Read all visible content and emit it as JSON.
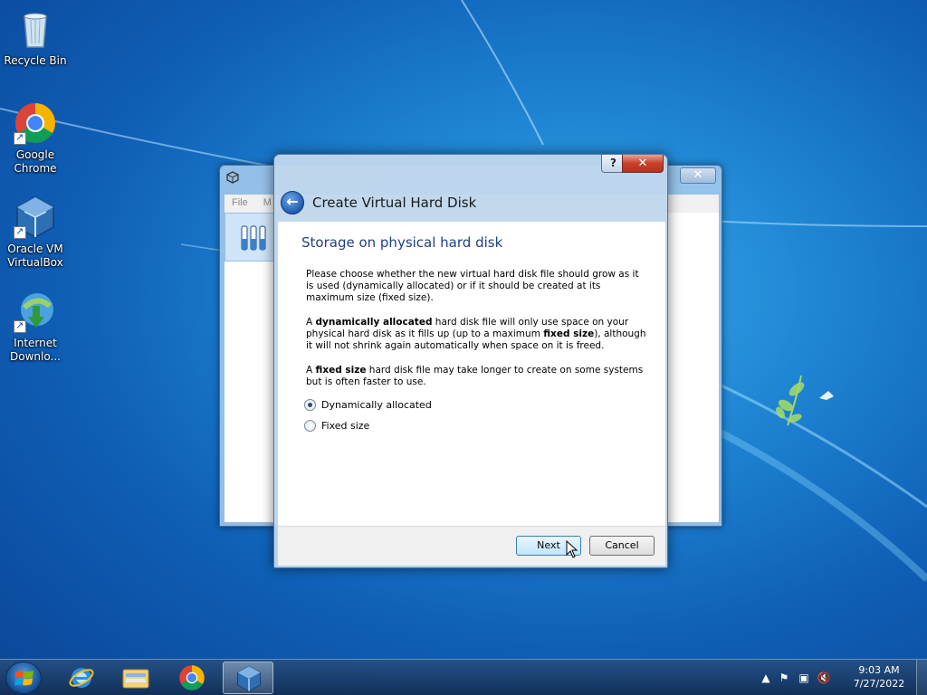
{
  "desktop": {
    "icons": [
      {
        "label": "Recycle Bin",
        "icon": "recycle-bin-icon"
      },
      {
        "label": "Google Chrome",
        "icon": "chrome-icon"
      },
      {
        "label": "Oracle VM VirtualBox",
        "icon": "virtualbox-icon"
      },
      {
        "label": "Internet Downlo...",
        "icon": "idm-icon"
      }
    ]
  },
  "background_window": {
    "menu_file": "File",
    "menu_m": "M"
  },
  "dialog": {
    "title": "Create Virtual Hard Disk",
    "help_label": "?",
    "close_label": "✕",
    "heading": "Storage on physical hard disk",
    "para1": "Please choose whether the new virtual hard disk file should grow as it is used (dynamically allocated) or if it should be created at its maximum size (fixed size).",
    "para2_a": "A ",
    "para2_b": "dynamically allocated",
    "para2_c": " hard disk file will only use space on your physical hard disk as it fills up (up to a maximum ",
    "para2_d": "fixed size",
    "para2_e": "), although it will not shrink again automatically when space on it is freed.",
    "para3_a": "A ",
    "para3_b": "fixed size",
    "para3_c": " hard disk file may take longer to create on some systems but is often faster to use.",
    "options": [
      {
        "label": "Dynamically allocated",
        "checked": true
      },
      {
        "label": "Fixed size",
        "checked": false
      }
    ],
    "next_label": "Next",
    "cancel_label": "Cancel"
  },
  "taskbar": {
    "items": [
      "internet-explorer-icon",
      "file-explorer-icon",
      "chrome-icon",
      "virtualbox-icon"
    ],
    "active_item": "virtualbox-icon",
    "time": "9:03 AM",
    "date": "7/27/2022"
  },
  "colors": {
    "heading_blue": "#1e3f84",
    "close_red": "#c7402a"
  }
}
